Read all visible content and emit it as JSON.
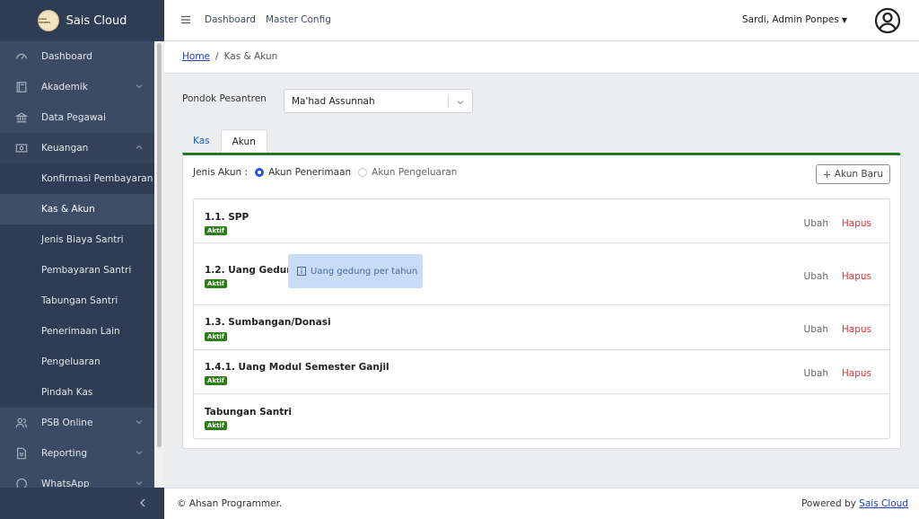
{
  "brand": {
    "name": "Sais Cloud",
    "logo_text": "LOGO PONPES"
  },
  "sidebar": {
    "items": [
      {
        "label": "Dashboard",
        "icon": "speedometer-icon"
      },
      {
        "label": "Akademik",
        "icon": "book-icon",
        "expandable": true
      },
      {
        "label": "Data Pegawai",
        "icon": "institution-icon"
      },
      {
        "label": "Keuangan",
        "icon": "money-icon",
        "expandable": true,
        "open": true
      }
    ],
    "keuangan_sub": [
      "Konfirmasi Pembayaran",
      "Kas & Akun",
      "Jenis Biaya Santri",
      "Pembayaran Santri",
      "Tabungan Santri",
      "Penerimaan Lain",
      "Pengeluaran",
      "Pindah Kas"
    ],
    "items_after": [
      {
        "label": "PSB Online",
        "icon": "users-icon"
      },
      {
        "label": "Reporting",
        "icon": "document-icon"
      },
      {
        "label": "WhatsApp",
        "icon": "whatsapp-icon"
      }
    ]
  },
  "header": {
    "nav": [
      "Dashboard",
      "Master Config"
    ],
    "user": "Sardi, Admin Ponpes"
  },
  "breadcrumb": {
    "home": "Home",
    "sep": "/",
    "current": "Kas & Akun"
  },
  "filter": {
    "label": "Pondok Pesantren",
    "value": "Ma'had Assunnah"
  },
  "tabs": [
    "Kas",
    "Akun"
  ],
  "active_tab": "Akun",
  "card": {
    "jenis_label": "Jenis Akun :",
    "radio_options": [
      "Akun Penerimaan",
      "Akun Pengeluaran"
    ],
    "selected_radio": "Akun Penerimaan",
    "add_button": "Akun Baru",
    "edit_label": "Ubah",
    "delete_label": "Hapus",
    "status_label": "Aktif",
    "accounts": [
      {
        "name": "1.1. SPP"
      },
      {
        "name": "1.2. Uang Gedung",
        "note": "Uang gedung per tahun"
      },
      {
        "name": "1.3. Sumbangan/Donasi"
      },
      {
        "name": "1.4.1. Uang Modul Semester Ganjil"
      },
      {
        "name": "Tabungan Santri"
      }
    ]
  },
  "footer": {
    "left": "© Ahsan Programmer.",
    "right_prefix": "Powered by",
    "right_link": "Sais Cloud"
  },
  "colors": {
    "sidebar": "#3c4b64",
    "accent_green": "#2e7d1a",
    "danger": "#dd3333",
    "link": "#1f3fb3"
  }
}
